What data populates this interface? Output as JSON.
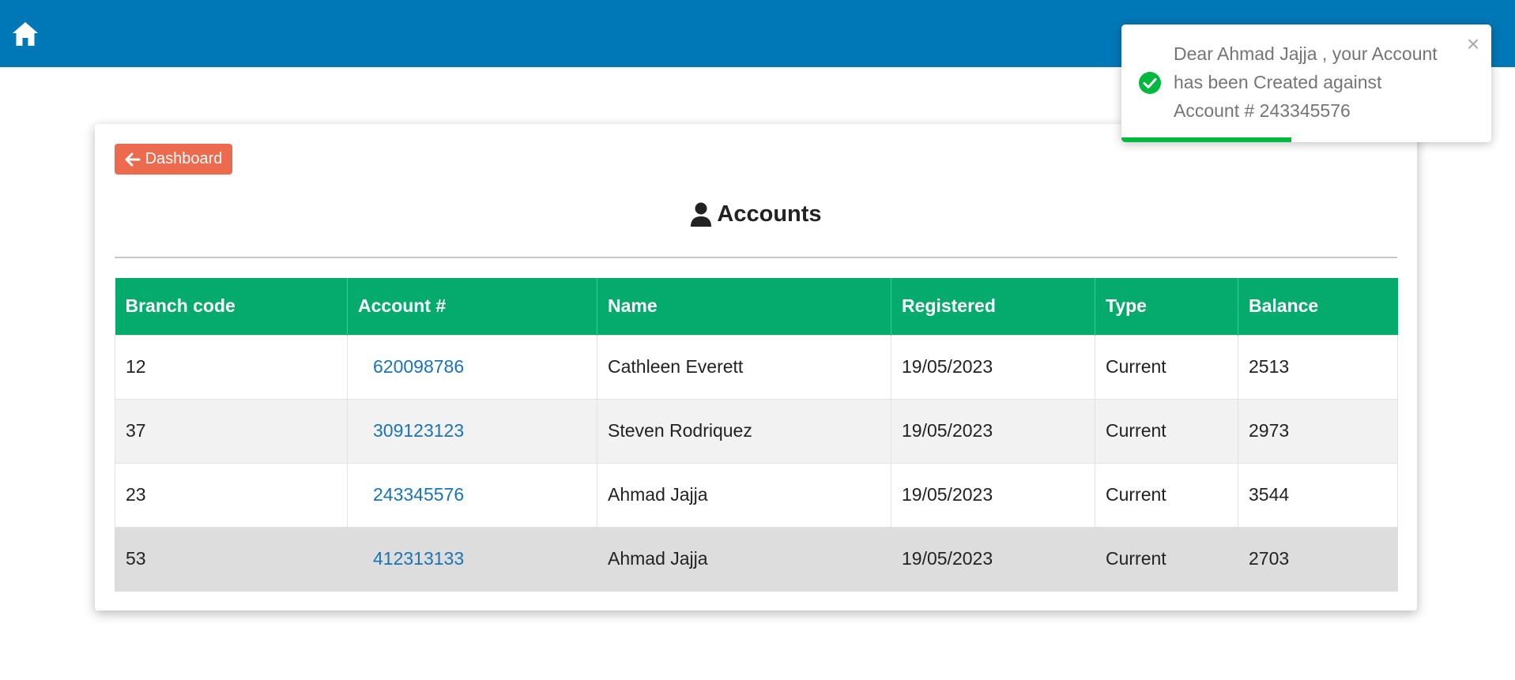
{
  "nav": {
    "home_icon": "home-icon",
    "bar_color": "#0077b6"
  },
  "back_button": {
    "icon": "arrow-left-icon",
    "label": "Dashboard",
    "color": "#ec6a4d"
  },
  "page": {
    "title_icon": "user-icon",
    "title": "Accounts"
  },
  "table": {
    "header_color": "#04ab6c",
    "columns": [
      "Branch code",
      "Account #",
      "Name",
      "Registered",
      "Type",
      "Balance"
    ],
    "rows": [
      {
        "branch": "12",
        "account": "620098786",
        "name": "Cathleen Everett",
        "registered": "19/05/2023",
        "type": "Current",
        "balance": "2513"
      },
      {
        "branch": "37",
        "account": "309123123",
        "name": "Steven Rodriquez",
        "registered": "19/05/2023",
        "type": "Current",
        "balance": "2973"
      },
      {
        "branch": "23",
        "account": "243345576",
        "name": "Ahmad Jajja",
        "registered": "19/05/2023",
        "type": "Current",
        "balance": "3544"
      },
      {
        "branch": "53",
        "account": "412313133",
        "name": "Ahmad Jajja",
        "registered": "19/05/2023",
        "type": "Current",
        "balance": "2703"
      }
    ]
  },
  "toast": {
    "icon": "check-circle-icon",
    "message_lines": [
      "Dear Ahmad Jajja , your Account",
      "has been Created against",
      "Account # 243345576"
    ],
    "close_label": "×",
    "progress": 0.46,
    "success_color": "#00b83e"
  }
}
